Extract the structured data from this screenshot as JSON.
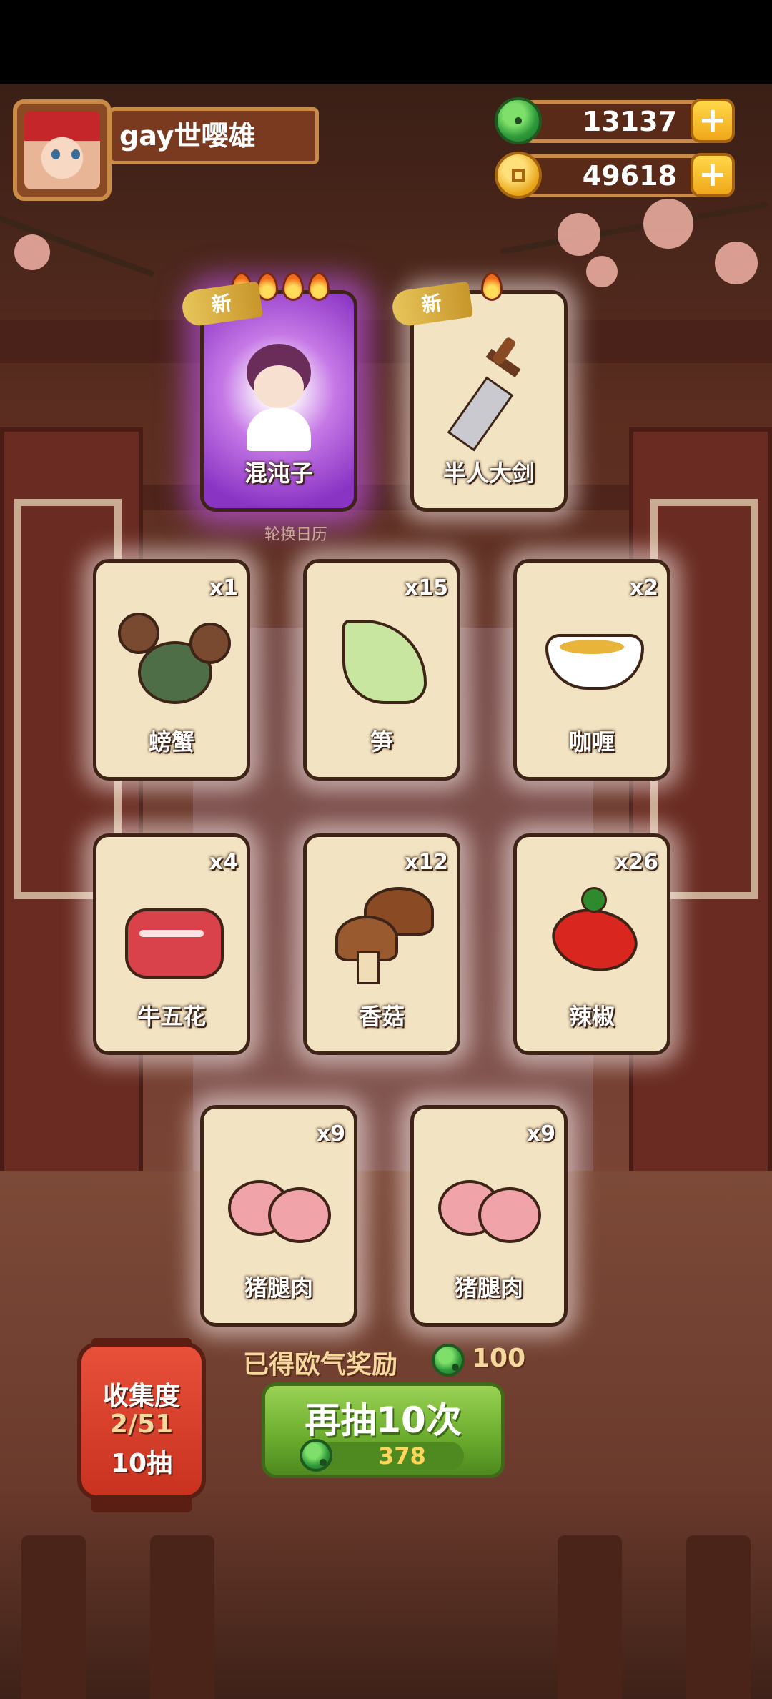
{
  "player": {
    "name": "gay世嘤雄"
  },
  "currencies": [
    {
      "type": "jade",
      "value": "13137"
    },
    {
      "type": "gold",
      "value": "49618"
    }
  ],
  "new_badge": "新",
  "featured_cards": [
    {
      "name": "混沌子",
      "flames": 4,
      "is_new": true,
      "rarity": "purple"
    },
    {
      "name": "半人大剑",
      "flames": 1,
      "is_new": true
    }
  ],
  "calendar_label": "轮换日历",
  "item_cards": [
    {
      "name": "螃蟹",
      "count": "x1"
    },
    {
      "name": "笋",
      "count": "x15"
    },
    {
      "name": "咖喱",
      "count": "x2"
    },
    {
      "name": "牛五花",
      "count": "x4"
    },
    {
      "name": "香菇",
      "count": "x12"
    },
    {
      "name": "辣椒",
      "count": "x26"
    },
    {
      "name": "猪腿肉",
      "count": "x9"
    },
    {
      "name": "猪腿肉",
      "count": "x9"
    }
  ],
  "reward": {
    "label": "已得欧气奖励",
    "value": "100"
  },
  "draw_button": {
    "label": "再抽10次",
    "cost": "378"
  },
  "collection": {
    "title": "收集度",
    "progress": "2/51",
    "draws": "10抽"
  },
  "colors": {
    "accent_green": "#6aab2d",
    "card_bg": "#f2e3c2",
    "gold": "#f0a719"
  }
}
